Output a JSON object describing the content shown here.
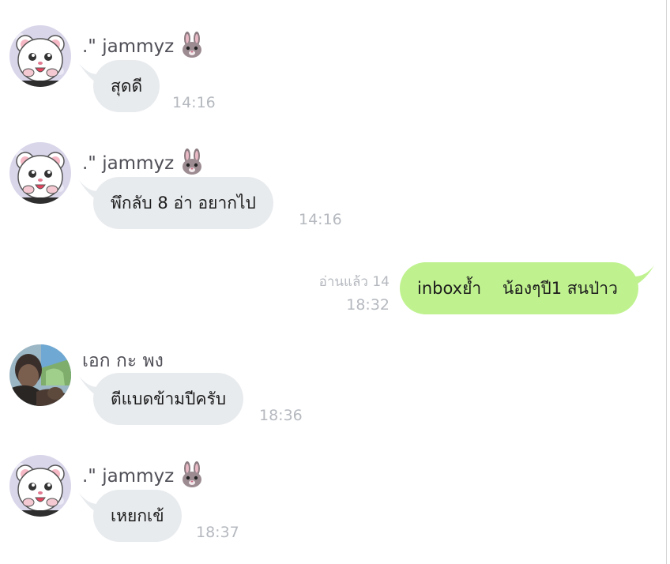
{
  "colors": {
    "incoming_bubble": "#e8ebee",
    "outgoing_bubble": "#bff28f",
    "timestamp": "#b5b9bf",
    "sender_name": "#505058"
  },
  "messages": [
    {
      "sender": ".\" jammyz",
      "sender_icon": "rabbit-icon",
      "avatar": "hamster-avatar",
      "text": "สุดดี",
      "time": "14:16"
    },
    {
      "sender": ".\" jammyz",
      "sender_icon": "rabbit-icon",
      "avatar": "hamster-avatar",
      "text": "พึกลับ 8 อ่า อยากไป",
      "time": "14:16"
    },
    {
      "text": "inboxย้ำ    น้องๆปี1 สนป่าว",
      "read_status": "อ่านแล้ว 14",
      "time": "18:32"
    },
    {
      "sender": "เอก กะ พง",
      "avatar": "photo-avatar",
      "text": "ตีแบดข้ามปีครับ",
      "time": "18:36"
    },
    {
      "sender": ".\" jammyz",
      "sender_icon": "rabbit-icon",
      "avatar": "hamster-avatar",
      "text": "เหยกเข้",
      "time": "18:37"
    }
  ]
}
